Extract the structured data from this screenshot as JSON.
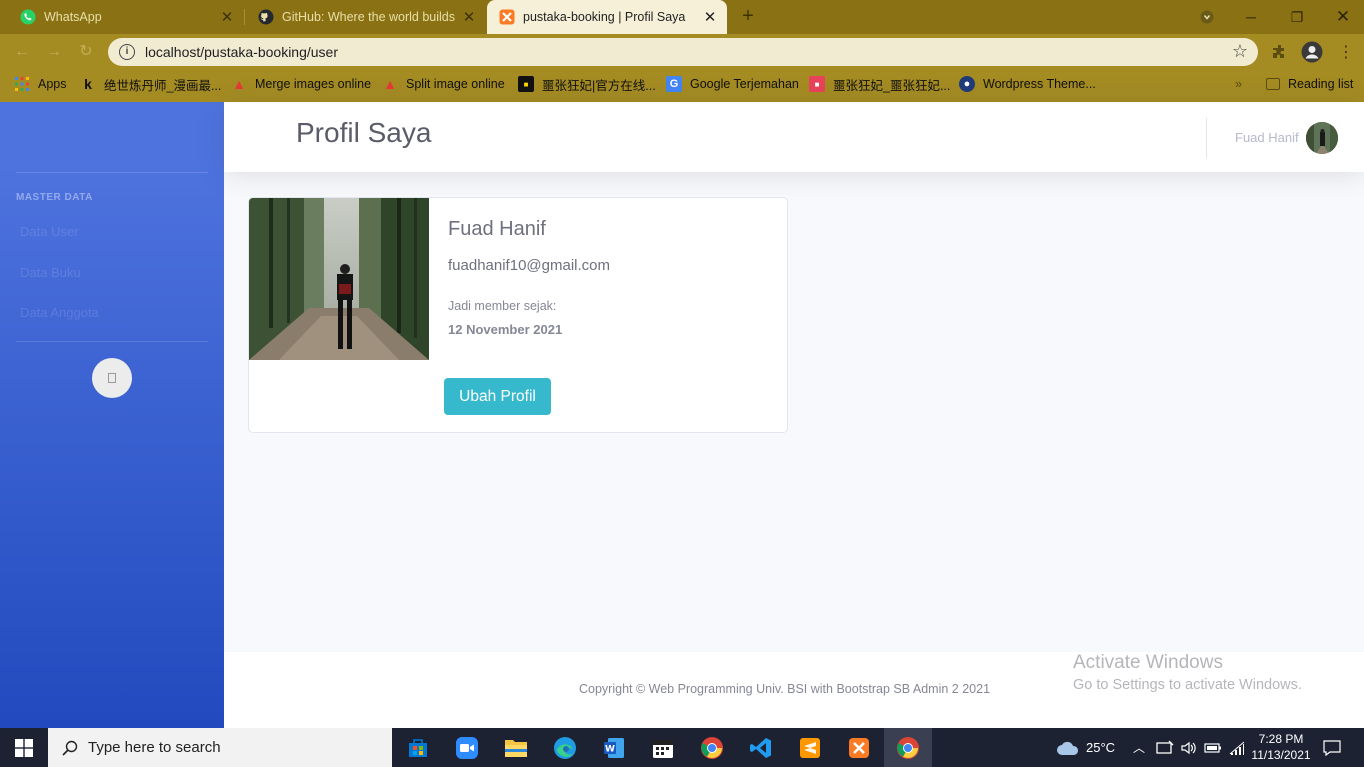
{
  "browser": {
    "tabs": [
      {
        "title": "WhatsApp",
        "icon": "whatsapp-icon",
        "active": false
      },
      {
        "title": "GitHub: Where the world builds",
        "icon": "github-icon",
        "active": false
      },
      {
        "title": "pustaka-booking | Profil Saya",
        "icon": "xampp-icon",
        "active": true
      }
    ],
    "url": "localhost/pustaka-booking/user",
    "bookmarks": [
      "Apps",
      "绝世炼丹师_漫画最...",
      "Merge images online",
      "Split image online",
      "噩张狂妃|官方在线...",
      "Google Terjemahan",
      "噩张狂妃_噩张狂妃...",
      "Wordpress Theme..."
    ],
    "reading_list": "Reading list"
  },
  "sidebar": {
    "heading": "MASTER DATA",
    "items": [
      "Data User",
      "Data Buku",
      "Data Anggota"
    ],
    "toggle_icon": "chevron-left-icon"
  },
  "topbar": {
    "title": "Profil Saya",
    "user_name": "Fuad Hanif"
  },
  "profile": {
    "name": "Fuad Hanif",
    "email": "fuadhanif10@gmail.com",
    "member_since_label": "Jadi member sejak:",
    "member_since_value": "12 November 2021",
    "edit_button": "Ubah Profil"
  },
  "footer": {
    "copyright": "Copyright © Web Programming Univ. BSI with Bootstrap SB Admin 2 2021"
  },
  "watermark": {
    "line1": "Activate Windows",
    "line2": "Go to Settings to activate Windows."
  },
  "taskbar": {
    "search_placeholder": "Type here to search",
    "weather": "25°C",
    "time": "7:28 PM",
    "date": "11/13/2021"
  }
}
